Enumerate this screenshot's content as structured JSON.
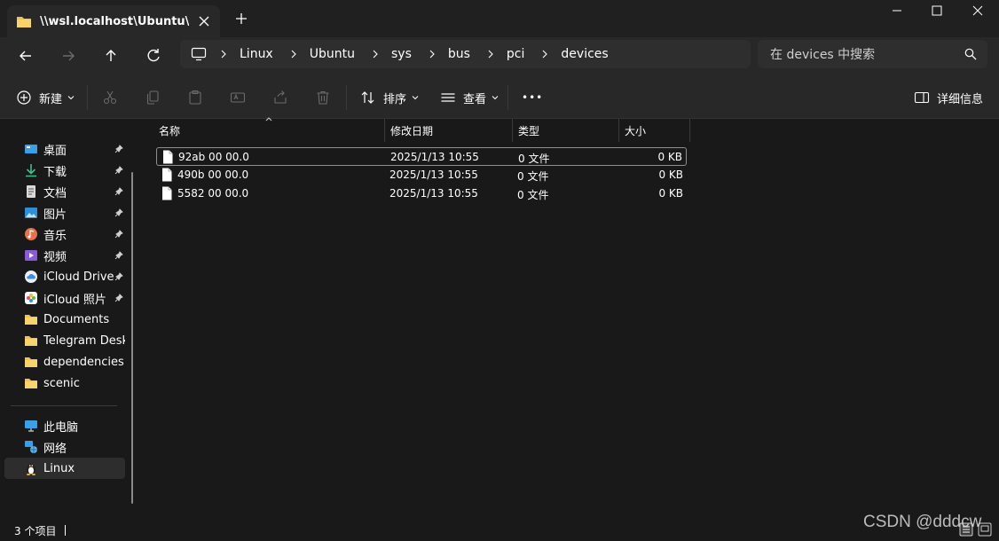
{
  "window": {
    "tab_title": "\\\\wsl.localhost\\Ubuntu\\sys\\bu",
    "new_tab_label": "+"
  },
  "address": {
    "crumbs": [
      "Linux",
      "Ubuntu",
      "sys",
      "bus",
      "pci",
      "devices"
    ],
    "search_placeholder": "在 devices 中搜索"
  },
  "toolbar": {
    "new_label": "新建",
    "sort_label": "排序",
    "view_label": "查看",
    "more_label": "•••",
    "details_label": "详细信息"
  },
  "sidebar": {
    "items": [
      {
        "label": "桌面",
        "icon": "desktop-icon",
        "pinned": true
      },
      {
        "label": "下载",
        "icon": "download-icon",
        "pinned": true
      },
      {
        "label": "文档",
        "icon": "document-icon",
        "pinned": true
      },
      {
        "label": "图片",
        "icon": "pictures-icon",
        "pinned": true
      },
      {
        "label": "音乐",
        "icon": "music-icon",
        "pinned": true
      },
      {
        "label": "视频",
        "icon": "video-icon",
        "pinned": true
      },
      {
        "label": "iCloud Drive",
        "icon": "icloud-icon",
        "pinned": true
      },
      {
        "label": "iCloud 照片",
        "icon": "icloud-photos-icon",
        "pinned": true
      },
      {
        "label": "Documents",
        "icon": "folder-icon",
        "pinned": false
      },
      {
        "label": "Telegram Deskt",
        "icon": "folder-icon",
        "pinned": false
      },
      {
        "label": "dependencies",
        "icon": "folder-icon",
        "pinned": false
      },
      {
        "label": "scenic",
        "icon": "folder-icon",
        "pinned": false
      }
    ],
    "devices": [
      {
        "label": "此电脑",
        "icon": "this-pc-icon"
      },
      {
        "label": "网络",
        "icon": "network-icon"
      },
      {
        "label": "Linux",
        "icon": "linux-icon",
        "selected": true
      }
    ]
  },
  "columns": {
    "name": "名称",
    "modified": "修改日期",
    "type": "类型",
    "size": "大小"
  },
  "files": [
    {
      "name": "92ab   00    00.0",
      "modified": "2025/1/13 10:55",
      "type": "0 文件",
      "size": "0 KB"
    },
    {
      "name": "490b   00    00.0",
      "modified": "2025/1/13 10:55",
      "type": "0 文件",
      "size": "0 KB"
    },
    {
      "name": "5582   00    00.0",
      "modified": "2025/1/13 10:55",
      "type": "0 文件",
      "size": "0 KB"
    }
  ],
  "status": {
    "count_text": "3 个项目"
  },
  "watermark": "CSDN @dddcw",
  "colors": {
    "background": "#191919",
    "folder": "#f2c14e",
    "accent": "#4cc2ff"
  }
}
